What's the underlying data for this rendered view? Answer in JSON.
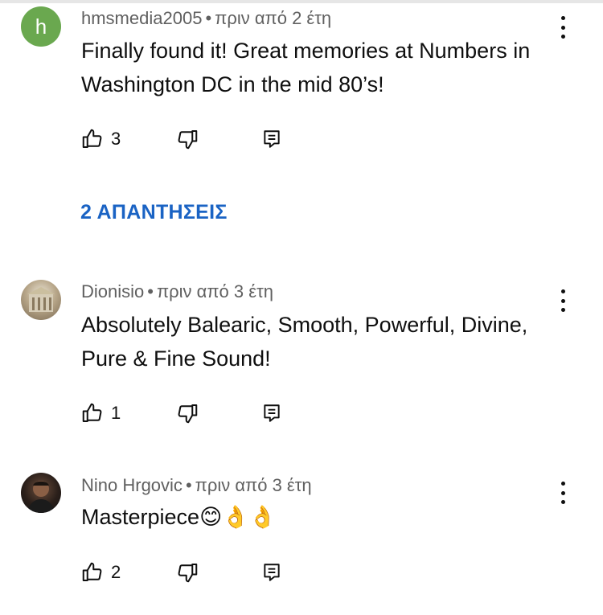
{
  "comments": [
    {
      "avatar_letter": "h",
      "avatar_color": "#6aa84f",
      "author": "hmsmedia2005",
      "separator": "•",
      "time": "πριν από 2 έτη",
      "text": "Finally found it! Great memories at Numbers in Washington DC in the mid 80’s!",
      "likes": "3"
    },
    {
      "avatar_kind": "photo",
      "author": "Dionisio",
      "separator": "•",
      "time": "πριν από 3 έτη",
      "text": "Absolutely Balearic, Smooth, Powerful, Divine, Pure & Fine Sound!",
      "likes": "1"
    },
    {
      "avatar_kind": "photo",
      "author": "Nino Hrgovic",
      "separator": "•",
      "time": "πριν από 3 έτη",
      "text": "Masterpiece😊👌👌",
      "likes": "2"
    }
  ],
  "replies_label": "2 ΑΠΑΝΤΗΣΕΙΣ",
  "icons": {
    "like": "thumbs-up-icon",
    "dislike": "thumbs-down-icon",
    "reply": "reply-icon",
    "more": "more-vert-icon"
  },
  "colors": {
    "link": "#1a63c4",
    "meta": "#606060",
    "text": "#0f0f0f"
  }
}
